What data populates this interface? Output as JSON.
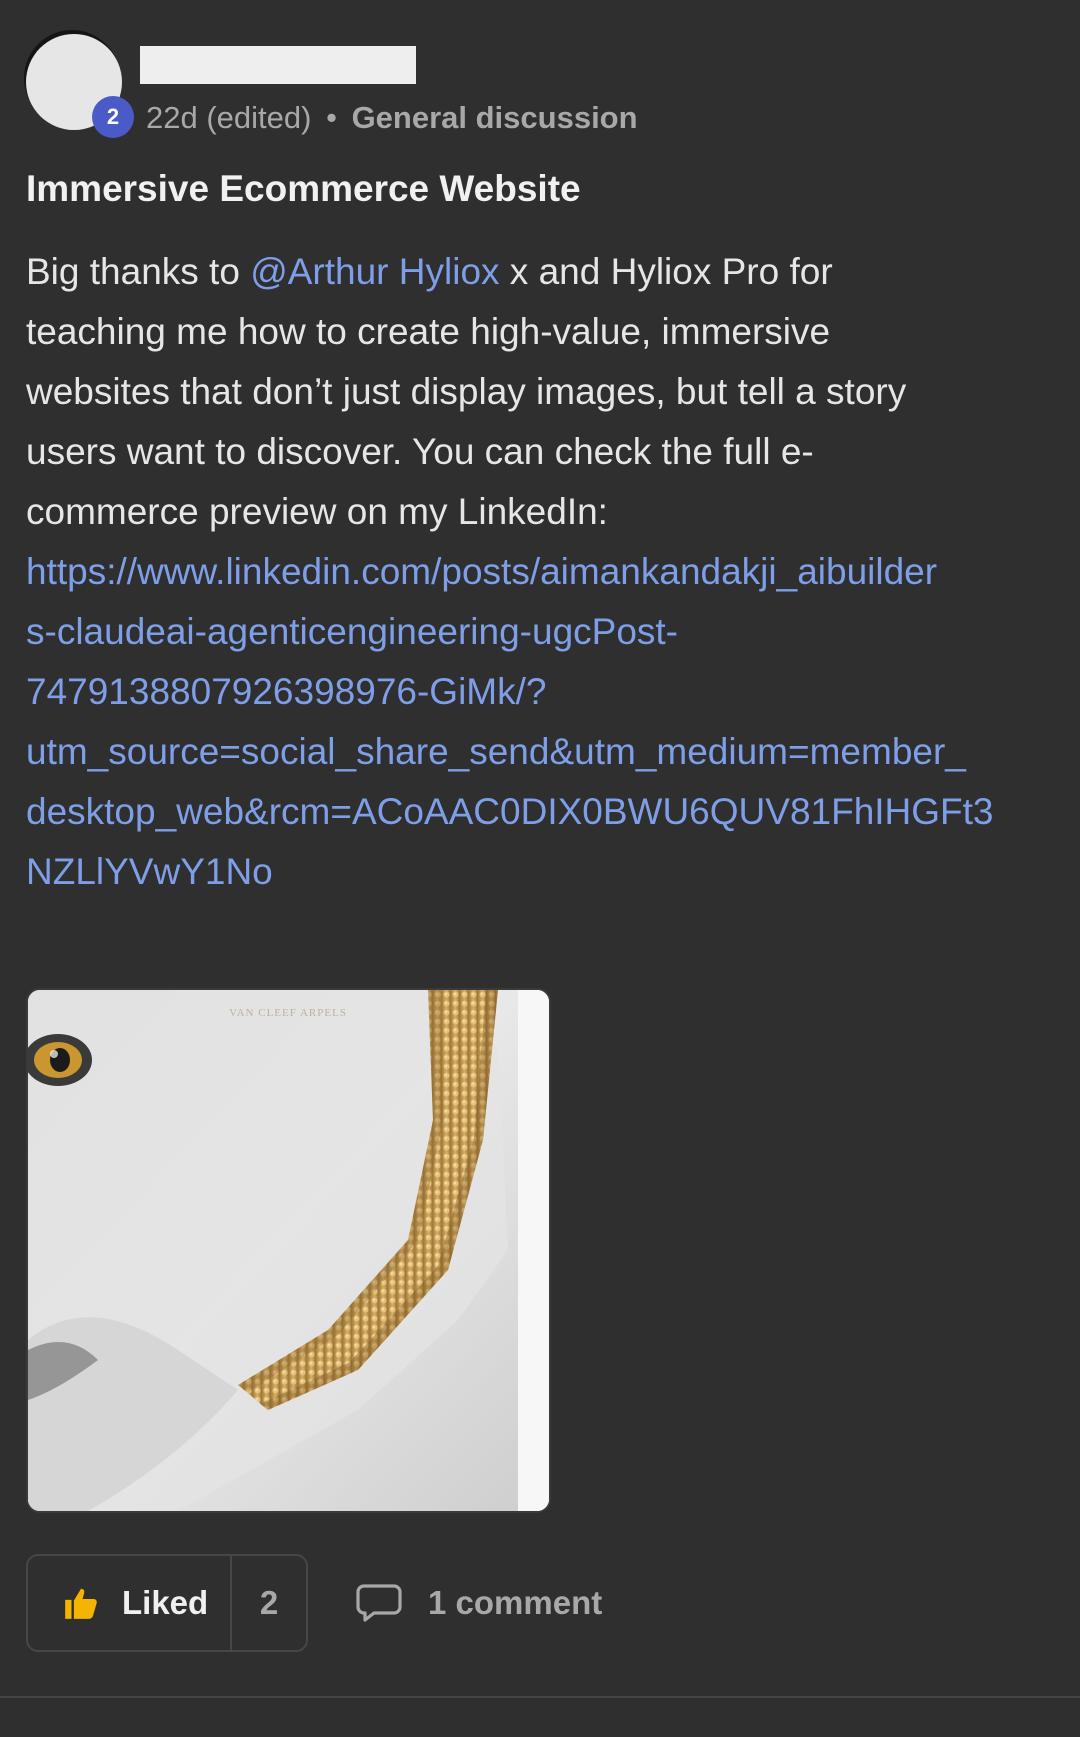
{
  "post": {
    "author": {
      "level": "2"
    },
    "meta": {
      "age": "22d (edited)",
      "separator": "•",
      "category": "General discussion"
    },
    "title": "Immersive Ecommerce Website",
    "body": {
      "line1_prefix": "Big thanks to ",
      "mention": "@Arthur Hyliox",
      "line1_suffix": " x and Hyliox Pro for",
      "line2": "teaching me how to create high-value, immersive",
      "line3": "websites that don’t just display images, but tell a story",
      "line4": "users want to discover. You can check the full e-",
      "line5": "commerce preview on my LinkedIn:",
      "link_lines": [
        "https://www.linkedin.com/posts/aimankandakji_aibuilder",
        "s-claudeai-agenticengineering-ugcPost-",
        "7479138807926398976-GiMk/?",
        "utm_source=social_share_send&utm_medium=member_",
        "desktop_web&rcm=ACoAAC0DIX0BWU6QUV81FhIHGFt3",
        "NZLlYVwY1No"
      ]
    },
    "image": {
      "watermark": "VAN CLEEF ARPELS"
    },
    "actions": {
      "like_label": "Liked",
      "like_count": "2",
      "comment_label": "1 comment"
    }
  },
  "colors": {
    "background": "#2f2f2f",
    "link": "#7e9fe8",
    "badge": "#4a5bc7",
    "muted": "#a8a8a8",
    "like_icon": "#f4b400"
  }
}
